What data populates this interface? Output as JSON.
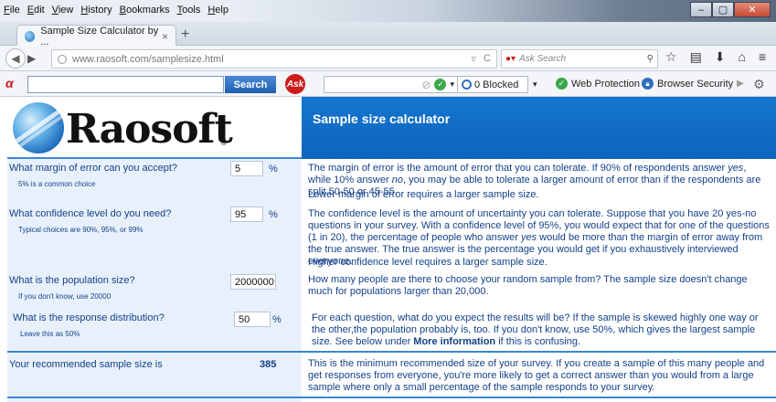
{
  "menu": [
    "File",
    "Edit",
    "View",
    "History",
    "Bookmarks",
    "Tools",
    "Help"
  ],
  "tab": {
    "title": "Sample Size Calculator by ...",
    "close": "×",
    "new": "+"
  },
  "nav": {
    "url": "www.raosoft.com/samplesize.html",
    "search_placeholder": "Ask Search",
    "ask_brand": "Ask"
  },
  "ask_toolbar": {
    "search_button": "Search",
    "blocked": "0 Blocked",
    "web_protection": "Web Protection",
    "browser_security": "Browser Security"
  },
  "page": {
    "logo": "Raosoft",
    "logo_mark": "®",
    "title": "Sample size calculator",
    "q1": {
      "label": "What margin of error can you accept?",
      "hint": "5% is a common choice",
      "value": "5",
      "unit": "%",
      "desc1_a": "The margin of error is the amount of error that you can tolerate. If 90% of respondents answer ",
      "desc1_yes": "yes",
      "desc1_b": ", while 10% answer ",
      "desc1_no": "no",
      "desc1_c": ", you may be able to tolerate a larger amount of error than if the respondents are split 50-50 or 45-55.",
      "desc2": "Lower margin of error requires a larger sample size."
    },
    "q2": {
      "label": "What confidence level do you need?",
      "hint": "Typical choices are 90%, 95%, or 99%",
      "value": "95",
      "unit": "%",
      "desc1_a": "The confidence level is the amount of uncertainty you can tolerate. Suppose that you have 20 yes-no questions in your survey. With a confidence level of 95%, you would expect that for one of the questions (1 in 20), the percentage of people who answer ",
      "desc1_yes": "yes",
      "desc1_b": " would be more than the margin of error away from the true answer. The true answer is the percentage you would get if you exhaustively interviewed everyone.",
      "desc2": "Higher confidence level requires a larger sample size."
    },
    "q3": {
      "label": "What is the population size?",
      "hint": "If you don't know, use 20000",
      "value": "2000000",
      "desc": "How many people are there to choose your random sample from? The sample size doesn't change much for populations larger than 20,000."
    },
    "q4": {
      "label": "What is the response distribution?",
      "hint": "Leave this as 50%",
      "value": "50",
      "unit": "%",
      "desc_a": "For each question, what do you expect the results will be? If the sample is skewed highly one way or the other,the population probably is, too. If you don't know, use 50%, which gives the largest sample size. See below under ",
      "desc_link": "More information",
      "desc_b": " if this is confusing."
    },
    "result": {
      "label": "Your recommended sample size is",
      "value": "385",
      "desc": "This is the minimum recommended size of your survey. If you create a sample of this many people and get responses from everyone, you're more likely to get a correct answer than you would from a large sample where only a small percentage of the sample responds to your survey."
    }
  }
}
